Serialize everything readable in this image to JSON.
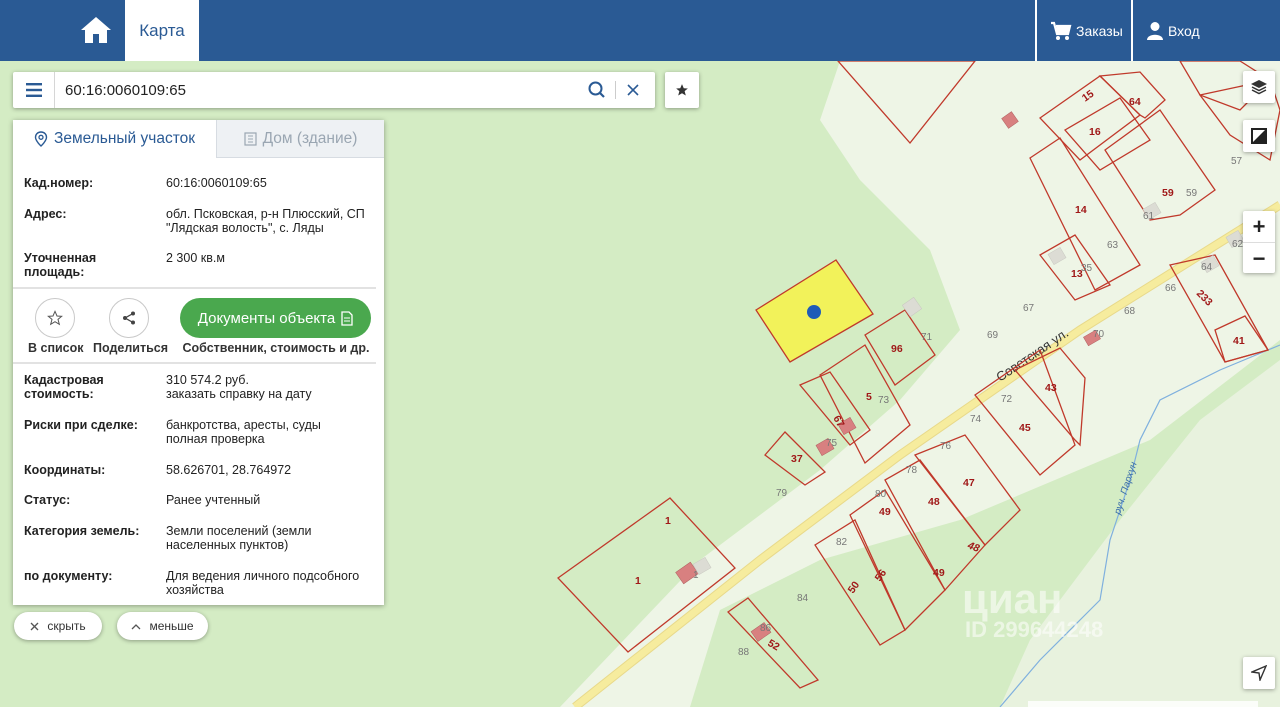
{
  "header": {
    "tab_map": "Карта",
    "orders_label": "Заказы",
    "login_label": "Вход"
  },
  "search": {
    "value": "60:16:0060109:65"
  },
  "panel": {
    "tabs": [
      "Земельный участок",
      "Дом (здание)"
    ],
    "rows": {
      "cad_label": "Кад.номер:",
      "cad_value": "60:16:0060109:65",
      "address_label": "Адрес:",
      "address_value": "обл. Псковская, р-н Плюсский, СП \"Лядская волость\", с. Ляды",
      "area_label": "Уточненная площадь:",
      "area_value": "2 300 кв.м",
      "cost_label": "Кадастровая стоимость:",
      "cost_value": "310 574.2 руб.",
      "cost_link": "заказать справку на дату",
      "risk_label": "Риски при сделке:",
      "risk_value": "банкротства, аресты, суды",
      "risk_link": "полная проверка",
      "coords_label": "Координаты:",
      "coords_value": "58.626701, 28.764972",
      "status_label": "Статус:",
      "status_value": "Ранее учтенный",
      "category_label": "Категория земель:",
      "category_value": "Земли поселений (земли населенных пунктов)",
      "doc_label": "по документу:",
      "doc_value": "Для ведения личного подсобного хозяйства"
    },
    "actions": {
      "add_list": "В список",
      "share": "Поделиться",
      "docs_button": "Документы объекта",
      "docs_sub": "Собственник, стоимость и др."
    }
  },
  "controls": {
    "hide_label": "скрыть",
    "less_label": "меньше",
    "zoom_in": "+",
    "zoom_out": "−"
  },
  "map": {
    "street_label": "Советская ул.",
    "stream_label": "руч. Пархун",
    "watermark": "циан",
    "watermark_id": "ID 299644248",
    "parcel_labels_red": [
      "15",
      "64",
      "16",
      "59",
      "14",
      "13",
      "96",
      "5",
      "43",
      "45",
      "47",
      "48",
      "48",
      "49",
      "49",
      "56",
      "50",
      "37",
      "1",
      "1",
      "52",
      "41",
      "233",
      "67"
    ],
    "house_numbers": [
      "57",
      "63",
      "61",
      "59",
      "62",
      "64",
      "66",
      "68",
      "67",
      "69",
      "70",
      "71",
      "72",
      "73",
      "74",
      "76",
      "75",
      "78",
      "79",
      "80",
      "82",
      "84",
      "86",
      "88",
      "35",
      "1"
    ]
  },
  "colors": {
    "header_bg": "#2a5a94",
    "map_bg": "#d4ecc4",
    "parcel_stroke": "#c0392b",
    "selected_fill": "#f2f25a",
    "road": "#f6ec9e",
    "docs_button": "#4aa84e"
  }
}
